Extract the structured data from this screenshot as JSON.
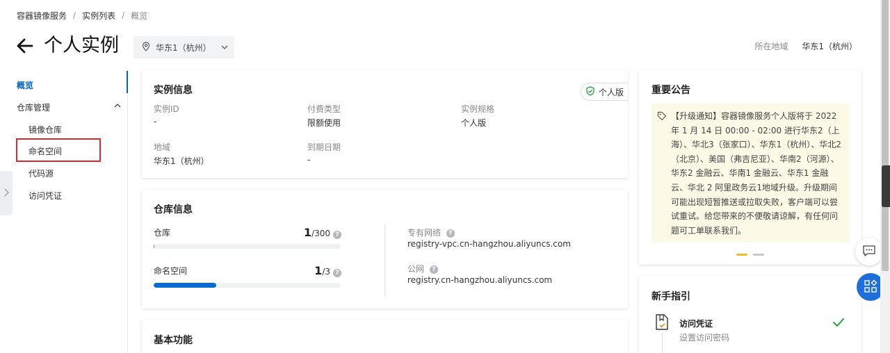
{
  "breadcrumb": {
    "items": [
      "容器镜像服务",
      "实例列表",
      "概览"
    ],
    "separator": "/"
  },
  "header": {
    "title": "个人实例",
    "region_select": "华东1（杭州）",
    "region_label": "所在地域",
    "region_value": "华东1（杭州）"
  },
  "sidebar": {
    "overview": "概览",
    "group": "仓库管理",
    "items": [
      "镜像仓库",
      "命名空间",
      "代码源",
      "访问凭证"
    ]
  },
  "instance_info": {
    "title": "实例信息",
    "badge": "个人版",
    "fields": [
      {
        "label": "实例ID",
        "value": "-"
      },
      {
        "label": "付费类型",
        "value": "限额使用"
      },
      {
        "label": "实例规格",
        "value": "个人版"
      },
      {
        "label": "地域",
        "value": "华东1（杭州）"
      },
      {
        "label": "到期日期",
        "value": "-"
      }
    ]
  },
  "repo_info": {
    "title": "仓库信息",
    "repo": {
      "label": "仓库",
      "used": "1",
      "total": "/300",
      "fraction": 0.0033
    },
    "namespace": {
      "label": "命名空间",
      "used": "1",
      "total": "/3",
      "fraction": 0.3333
    },
    "vpc": {
      "label": "专有网络",
      "value": "registry-vpc.cn-hangzhou.aliyuncs.com"
    },
    "public": {
      "label": "公网",
      "value": "registry.cn-hangzhou.aliyuncs.com"
    }
  },
  "basic_functions": {
    "title": "基本功能"
  },
  "announcement": {
    "title": "重要公告",
    "text": "【升级通知】容器镜像服务个人版将于 2022 年 1 月 14 日 00:00 - 02:00 进行华东2（上海）、华北3（张家口）、华东1（杭州）、华北2（北京）、美国（弗吉尼亚）、华南2（河源）、华东2 金融云、华南1 金融云、华东1 金融云、华北 2 阿里政务云1地域升级。升级期间可能出现短暂推送或拉取失败，客户端可以尝试重试。给您带来的不便敬请谅解，有任何问题可工单联系我们。"
  },
  "guide": {
    "title": "新手指引",
    "step_title": "访问凭证",
    "step_desc": "设置访问密码"
  },
  "colors": {
    "primary": "#0064c8",
    "highlight": "#e0282e",
    "success": "#23a03c",
    "notice_bg": "#fdf9e7",
    "dot_active": "#f5b82e"
  }
}
